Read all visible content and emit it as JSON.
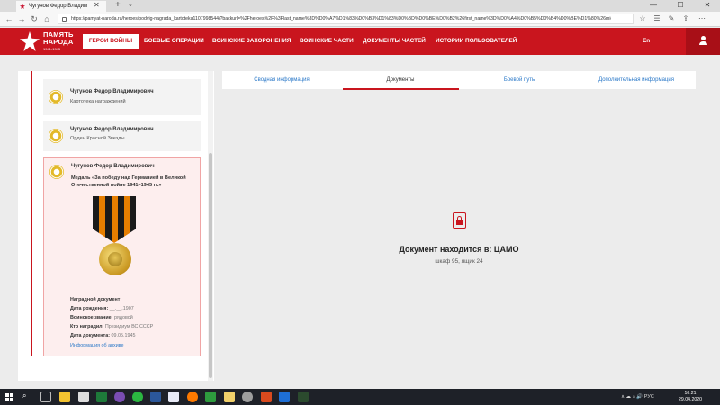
{
  "browser": {
    "tab_title": "Чугунов Федор Владим",
    "tab_close": "✕",
    "new_tab": "+",
    "tab_menu": "⌄",
    "url": "https://pamyat-naroda.ru/heroes/podvig-nagrada_kartoteka1107998544/?backurl=%2Fheroes%2F%3Flast_name%3D%D0%A7%D1%83%D0%B3%D1%83%D0%BD%D0%BE%D0%B2%26first_name%3D%D0%A4%D0%B5%D0%B4%D0%BE%D1%80%26midd",
    "win_min": "—",
    "win_max": "☐",
    "win_close": "✕",
    "nav_back": "←",
    "nav_forward": "→",
    "nav_refresh": "↻",
    "nav_home": "⌂",
    "toolbar_icons": [
      "☆",
      "☰",
      "✎",
      "⇪",
      "⋯"
    ]
  },
  "site": {
    "logo_line1": "ПАМЯТЬ",
    "logo_line2": "НАРОДА",
    "logo_years": "1941-1945",
    "nav": [
      {
        "label": "ГЕРОИ ВОЙНЫ"
      },
      {
        "label": "БОЕВЫЕ ОПЕРАЦИИ"
      },
      {
        "label": "ВОИНСКИЕ ЗАХОРОНЕНИЯ"
      },
      {
        "label": "ВОИНСКИЕ ЧАСТИ"
      },
      {
        "label": "ДОКУМЕНТЫ ЧАСТЕЙ"
      },
      {
        "label": "ИСТОРИИ ПОЛЬЗОВАТЕЛЕЙ"
      }
    ],
    "lang": "En",
    "accent_color": "#c9151e"
  },
  "cards": [
    {
      "name": "Чугунов Федор Владимирович",
      "subtitle": "Картотека награждений"
    },
    {
      "name": "Чугунов Федор Владимирович",
      "subtitle": "Орден Красной Звезды"
    },
    {
      "name": "Чугунов Федор Владимирович",
      "award": "Медаль «За победу над Германией в Великой Отечественной войне 1941–1945 гг.»",
      "doc_title": "Наградной документ",
      "fields": [
        {
          "label": "Дата рождения:",
          "value": "__.__.1907"
        },
        {
          "label": "Воинское звание:",
          "value": "рядовой"
        },
        {
          "label": "Кто наградил:",
          "value": "Президиум ВС СССР"
        },
        {
          "label": "Дата документа:",
          "value": "09.05.1945"
        }
      ],
      "link": "Информация об архиве"
    }
  ],
  "tabs": [
    {
      "label": "Сводная информация"
    },
    {
      "label": "Документы"
    },
    {
      "label": "Боевой путь"
    },
    {
      "label": "Дополнительная информация"
    }
  ],
  "active_tab": "Документы",
  "document": {
    "location_title": "Документ находится в: ЦАМО",
    "location_sub": "шкаф 95, ящик 24"
  },
  "taskbar": {
    "search_icon": "⌕",
    "tray": "∧  ☁  ⌂  🔊  РУС",
    "time": "10:21",
    "date": "29.04.2020"
  }
}
